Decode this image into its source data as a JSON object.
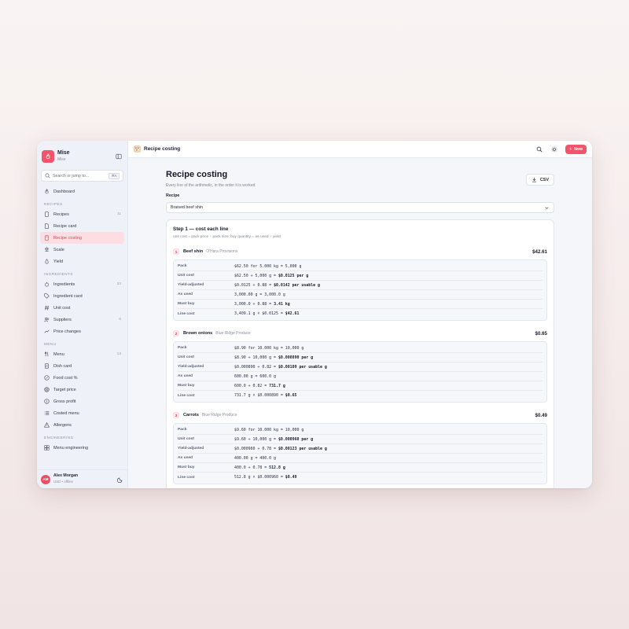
{
  "app": {
    "name": "Mise",
    "subtitle": "Mise"
  },
  "search": {
    "placeholder": "Search or jump to...",
    "shortcut": "⌘K"
  },
  "sidebar": {
    "dashboard": "Dashboard",
    "sections": [
      {
        "label": "RECIPES",
        "items": [
          {
            "label": "Recipes",
            "count": "11",
            "icon": "file-icon"
          },
          {
            "label": "Recipe card",
            "count": "",
            "icon": "document-icon"
          },
          {
            "label": "Recipe costing",
            "count": "",
            "icon": "calculator-icon",
            "active": true
          },
          {
            "label": "Scale",
            "count": "",
            "icon": "scale-icon"
          },
          {
            "label": "Yield",
            "count": "",
            "icon": "droplet-icon"
          }
        ]
      },
      {
        "label": "INGREDIENTS",
        "items": [
          {
            "label": "Ingredients",
            "count": "33",
            "icon": "apple-icon"
          },
          {
            "label": "Ingredient card",
            "count": "",
            "icon": "tag-icon"
          },
          {
            "label": "Unit cost",
            "count": "",
            "icon": "hash-icon"
          },
          {
            "label": "Suppliers",
            "count": "6",
            "icon": "users-icon"
          },
          {
            "label": "Price changes",
            "count": "",
            "icon": "trend-icon"
          }
        ]
      },
      {
        "label": "MENU",
        "items": [
          {
            "label": "Menu",
            "count": "13",
            "icon": "utensils-icon"
          },
          {
            "label": "Dish card",
            "count": "",
            "icon": "card-icon"
          },
          {
            "label": "Food cost %",
            "count": "",
            "icon": "percent-icon"
          },
          {
            "label": "Target price",
            "count": "",
            "icon": "target-icon"
          },
          {
            "label": "Gross profit",
            "count": "",
            "icon": "coins-icon"
          },
          {
            "label": "Costed menu",
            "count": "",
            "icon": "list-icon"
          },
          {
            "label": "Allergens",
            "count": "",
            "icon": "warning-icon"
          }
        ]
      },
      {
        "label": "ENGINEERING",
        "items": [
          {
            "label": "Menu engineering",
            "count": "",
            "icon": "grid-icon"
          }
        ]
      }
    ]
  },
  "user": {
    "initials": "AM",
    "name": "Alex Morgan",
    "meta": "USD • offline"
  },
  "topbar": {
    "title": "Recipe costing",
    "new_label": "New"
  },
  "page": {
    "title": "Recipe costing",
    "subtitle": "Every line of the arithmetic, in the order it is worked",
    "csv_label": "CSV",
    "recipe_label": "Recipe",
    "recipe_value": "Braised beef shin"
  },
  "step": {
    "title": "Step 1 — cost each line",
    "subtitle": "unit cost = pack price ÷ pack size; buy quantity = as-used ÷ yield"
  },
  "lines": [
    {
      "num": "1",
      "name": "Beef shin",
      "supplier": "O'Hara Provisions",
      "total": "$42.61",
      "rows": [
        {
          "label": "Pack",
          "expr": "$62.50 for 5.000 kg = 5,000 g",
          "result": ""
        },
        {
          "label": "Unit cost",
          "expr": "$62.50 ÷ 5,000 g = ",
          "result": "$0.0125 per g"
        },
        {
          "label": "Yield-adjusted",
          "expr": "$0.0125 ÷ 0.88 = ",
          "result": "$0.0142 per usable g"
        },
        {
          "label": "As used",
          "expr": "3,000.00 g = 3,000.0 g",
          "result": ""
        },
        {
          "label": "Must buy",
          "expr": "3,000.0 ÷ 0.88 = ",
          "result": "3.41 kg"
        },
        {
          "label": "Line cost",
          "expr": "3,409.1 g × $0.0125 = ",
          "result": "$42.61"
        }
      ]
    },
    {
      "num": "2",
      "name": "Brown onions",
      "supplier": "Blue Ridge Produce",
      "total": "$0.65",
      "rows": [
        {
          "label": "Pack",
          "expr": "$8.90 for 10.000 kg = 10,000 g",
          "result": ""
        },
        {
          "label": "Unit cost",
          "expr": "$8.90 ÷ 10,000 g = ",
          "result": "$0.000890 per g"
        },
        {
          "label": "Yield-adjusted",
          "expr": "$0.000890 ÷ 0.82 = ",
          "result": "$0.00109 per usable g"
        },
        {
          "label": "As used",
          "expr": "600.00 g = 600.0 g",
          "result": ""
        },
        {
          "label": "Must buy",
          "expr": "600.0 ÷ 0.82 = ",
          "result": "731.7 g"
        },
        {
          "label": "Line cost",
          "expr": "731.7 g × $0.000890 = ",
          "result": "$0.65"
        }
      ]
    },
    {
      "num": "3",
      "name": "Carrots",
      "supplier": "Blue Ridge Produce",
      "total": "$0.49",
      "rows": [
        {
          "label": "Pack",
          "expr": "$9.60 for 10.000 kg = 10,000 g",
          "result": ""
        },
        {
          "label": "Unit cost",
          "expr": "$9.60 ÷ 10,000 g = ",
          "result": "$0.000960 per g"
        },
        {
          "label": "Yield-adjusted",
          "expr": "$0.000960 ÷ 0.78 = ",
          "result": "$0.00123 per usable g"
        },
        {
          "label": "As used",
          "expr": "400.00 g = 400.0 g",
          "result": ""
        },
        {
          "label": "Must buy",
          "expr": "400.0 ÷ 0.78 = ",
          "result": "512.8 g"
        },
        {
          "label": "Line cost",
          "expr": "512.8 g × $0.000960 = ",
          "result": "$0.49"
        }
      ]
    }
  ],
  "colors": {
    "accent": "#f2546b",
    "active_bg": "#fbdde2",
    "sidebar_bg": "#eef1f7"
  }
}
